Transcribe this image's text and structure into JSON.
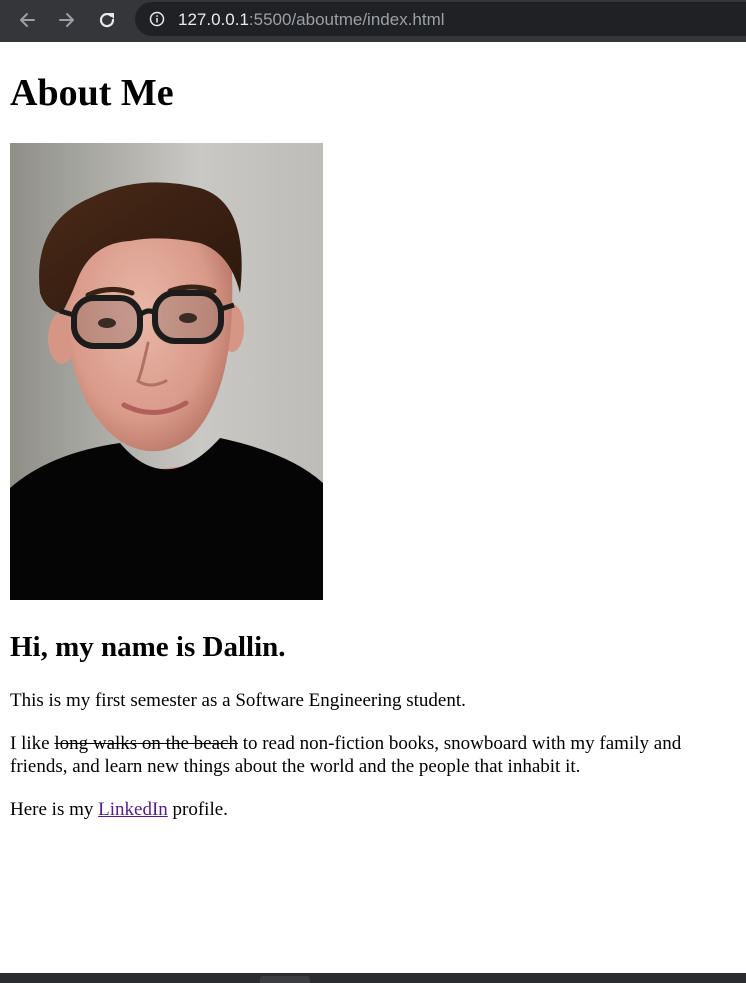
{
  "browser": {
    "url_host": "127.0.0.1",
    "url_rest": ":5500/aboutme/index.html",
    "icons": {
      "back": "arrow-left-icon",
      "forward": "arrow-right-icon",
      "reload": "reload-icon",
      "site_info": "info-icon"
    }
  },
  "page": {
    "title": "About Me",
    "photo_alt": "portrait photo",
    "heading": "Hi, my name is Dallin.",
    "paragraph1": "This is my first semester as a Software Engineering student.",
    "paragraph2": {
      "prefix": "I like ",
      "struck": "long walks on the beach",
      "suffix": " to read non-fiction books, snowboard with my family and friends, and learn new things about the world and the people that inhabit it."
    },
    "paragraph3": {
      "prefix": "Here is my ",
      "link": "LinkedIn",
      "suffix": " profile."
    }
  }
}
